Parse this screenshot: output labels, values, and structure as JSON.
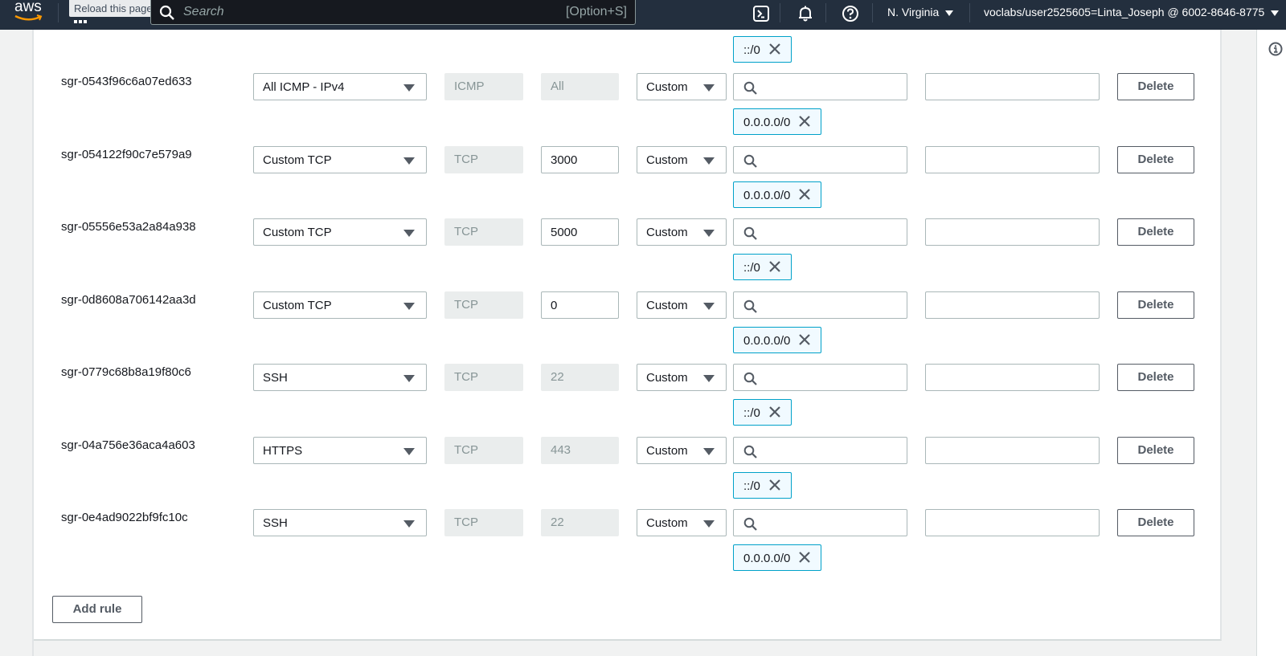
{
  "topnav": {
    "logo_text": "aws",
    "tooltip": "Reload this page",
    "search_placeholder": "Search",
    "search_shortcut": "[Option+S]",
    "region": "N. Virginia",
    "account": "voclabs/user2525605=Linta_Joseph @ 6002-8646-8775",
    "icons": [
      "cloudshell-icon",
      "notifications-bell-icon",
      "help-icon"
    ]
  },
  "top_token": {
    "value": "::/0"
  },
  "rules": [
    {
      "id": "sgr-0543f96c6a07ed633",
      "type": "All ICMP - IPv4",
      "protocol": "ICMP",
      "port_range": "All",
      "port_editable": false,
      "source_type": "Custom",
      "source_search": "",
      "description": "",
      "source_token": "0.0.0.0/0"
    },
    {
      "id": "sgr-054122f90c7e579a9",
      "type": "Custom TCP",
      "protocol": "TCP",
      "port_range": "3000",
      "port_editable": true,
      "source_type": "Custom",
      "source_search": "",
      "description": "",
      "source_token": "0.0.0.0/0"
    },
    {
      "id": "sgr-05556e53a2a84a938",
      "type": "Custom TCP",
      "protocol": "TCP",
      "port_range": "5000",
      "port_editable": true,
      "source_type": "Custom",
      "source_search": "",
      "description": "",
      "source_token": "::/0"
    },
    {
      "id": "sgr-0d8608a706142aa3d",
      "type": "Custom TCP",
      "protocol": "TCP",
      "port_range": "0",
      "port_editable": true,
      "source_type": "Custom",
      "source_search": "",
      "description": "",
      "source_token": "0.0.0.0/0"
    },
    {
      "id": "sgr-0779c68b8a19f80c6",
      "type": "SSH",
      "protocol": "TCP",
      "port_range": "22",
      "port_editable": false,
      "source_type": "Custom",
      "source_search": "",
      "description": "",
      "source_token": "::/0"
    },
    {
      "id": "sgr-04a756e36aca4a603",
      "type": "HTTPS",
      "protocol": "TCP",
      "port_range": "443",
      "port_editable": false,
      "source_type": "Custom",
      "source_search": "",
      "description": "",
      "source_token": "::/0"
    },
    {
      "id": "sgr-0e4ad9022bf9fc10c",
      "type": "SSH",
      "protocol": "TCP",
      "port_range": "22",
      "port_editable": false,
      "source_type": "Custom",
      "source_search": "",
      "description": "",
      "source_token": "0.0.0.0/0"
    }
  ],
  "labels": {
    "delete": "Delete",
    "add_rule": "Add rule"
  },
  "colors": {
    "nav_bg": "#232f3e",
    "token_border": "#00a1c9",
    "token_bg": "#f1faff"
  }
}
